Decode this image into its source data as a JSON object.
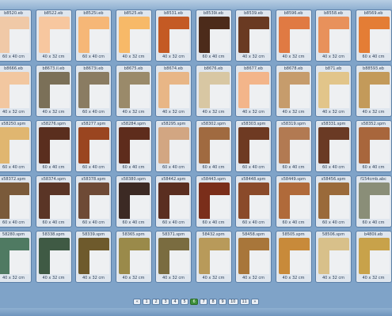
{
  "cards": [
    {
      "code": "b8520.eb",
      "size": "60 x 40 cm",
      "color": "#f0c9a7"
    },
    {
      "code": "b8522.eb",
      "size": "40 x 32 cm",
      "color": "#f7c79f"
    },
    {
      "code": "b8525i.eb",
      "size": "60 x 40 cm",
      "color": "#f6b777"
    },
    {
      "code": "b8525.eb",
      "size": "40 x 32 cm",
      "color": "#f7b968"
    },
    {
      "code": "b8531.eb",
      "size": "40 x 32 cm",
      "color": "#c45a24"
    },
    {
      "code": "b8539i.eb",
      "size": "60 x 40 cm",
      "color": "#4c2b1a"
    },
    {
      "code": "b8539.eb",
      "size": "40 x 32 cm",
      "color": "#6a3a22"
    },
    {
      "code": "b8596.eb",
      "size": "40 x 32 cm",
      "color": "#e07a43"
    },
    {
      "code": "b8558.eb",
      "size": "40 x 32 cm",
      "color": "#e8915b"
    },
    {
      "code": "b8569.eb",
      "size": "60 x 40 cm",
      "color": "#e47d35"
    },
    {
      "code": "b8666.eb",
      "size": "40 x 32 cm",
      "color": "#f2c7a0"
    },
    {
      "code": "b8673.il.eb",
      "size": "40 x 32 cm",
      "color": "#7b7058"
    },
    {
      "code": "b8673i.eb",
      "size": "60 x 40 cm",
      "color": "#8a7c62"
    },
    {
      "code": "b8675.eb",
      "size": "40 x 32 cm",
      "color": "#9a8a6a"
    },
    {
      "code": "b8674.eb",
      "size": "40 x 32 cm",
      "color": "#e8b686"
    },
    {
      "code": "b8676.eb",
      "size": "40 x 32 cm",
      "color": "#d8c7a3"
    },
    {
      "code": "b8677.eb",
      "size": "40 x 32 cm",
      "color": "#f3b58a"
    },
    {
      "code": "b8678.eb",
      "size": "40 x 32 cm",
      "color": "#c69c6c"
    },
    {
      "code": "b871.eb",
      "size": "40 x 32 cm",
      "color": "#e2c58a"
    },
    {
      "code": "b88593.eb",
      "size": "40 x 32 cm",
      "color": "#c39a5a"
    },
    {
      "code": "s58250.spm",
      "size": "60 x 40 cm",
      "color": "#e0b670"
    },
    {
      "code": "s58276.spm",
      "size": "60 x 40 cm",
      "color": "#5a2e1e"
    },
    {
      "code": "s58277.spm",
      "size": "60 x 40 cm",
      "color": "#9a4520"
    },
    {
      "code": "s58284.spm",
      "size": "60 x 40 cm",
      "color": "#5e2c1c"
    },
    {
      "code": "s58295.spm",
      "size": "60 x 40 cm",
      "color": "#d2a682"
    },
    {
      "code": "s58302.spm",
      "size": "60 x 40 cm",
      "color": "#a06a40"
    },
    {
      "code": "s58303.spm",
      "size": "60 x 40 cm",
      "color": "#6e3a22"
    },
    {
      "code": "s58319.spm",
      "size": "60 x 40 cm",
      "color": "#b27a52"
    },
    {
      "code": "s58331.spm",
      "size": "60 x 40 cm",
      "color": "#6a3a24"
    },
    {
      "code": "s58352.spm",
      "size": "60 x 40 cm",
      "color": "#a8663c"
    },
    {
      "code": "s58372.spm",
      "size": "60 x 40 cm",
      "color": "#7a5a3a"
    },
    {
      "code": "s58374.spm",
      "size": "60 x 40 cm",
      "color": "#5a3526"
    },
    {
      "code": "s58378.spm",
      "size": "60 x 40 cm",
      "color": "#6e4a36"
    },
    {
      "code": "s58380.spm",
      "size": "60 x 40 cm",
      "color": "#3c2a24"
    },
    {
      "code": "s58442.spm",
      "size": "60 x 40 cm",
      "color": "#5a2e20"
    },
    {
      "code": "s58443.spm",
      "size": "60 x 40 cm",
      "color": "#7a2e1a"
    },
    {
      "code": "s58448.spm",
      "size": "60 x 40 cm",
      "color": "#8a4a2a"
    },
    {
      "code": "s58449.spm",
      "size": "60 x 40 cm",
      "color": "#b06a3a"
    },
    {
      "code": "s58456.spm",
      "size": "60 x 40 cm",
      "color": "#9a6a3a"
    },
    {
      "code": "f154cmb.abc",
      "size": "60 x 40 cm",
      "color": "#8a8e78"
    },
    {
      "code": "58280.spm",
      "size": "40 x 32 cm",
      "color": "#4f7a62"
    },
    {
      "code": "58338.spm",
      "size": "40 x 32 cm",
      "color": "#3f5a44"
    },
    {
      "code": "58339.spm",
      "size": "40 x 32 cm",
      "color": "#6e5a2c"
    },
    {
      "code": "58365.spm",
      "size": "40 x 32 cm",
      "color": "#9a8a4a"
    },
    {
      "code": "58371.spm",
      "size": "40 x 32 cm",
      "color": "#7a6c40"
    },
    {
      "code": "58432.spm",
      "size": "40 x 32 cm",
      "color": "#b89a5a"
    },
    {
      "code": "58458.spm",
      "size": "40 x 32 cm",
      "color": "#a8763a"
    },
    {
      "code": "58505.spm",
      "size": "40 x 32 cm",
      "color": "#c88a3a"
    },
    {
      "code": "58506.spm",
      "size": "40 x 32 cm",
      "color": "#d8c08a"
    },
    {
      "code": "b480li.eb",
      "size": "40 x 32 cm",
      "color": "#c8a24a"
    }
  ],
  "pager": [
    "«",
    "1",
    "2",
    "3",
    "4",
    "5",
    "6",
    "7",
    "8",
    "9",
    "10",
    "11",
    "»"
  ],
  "pager_active": "6"
}
